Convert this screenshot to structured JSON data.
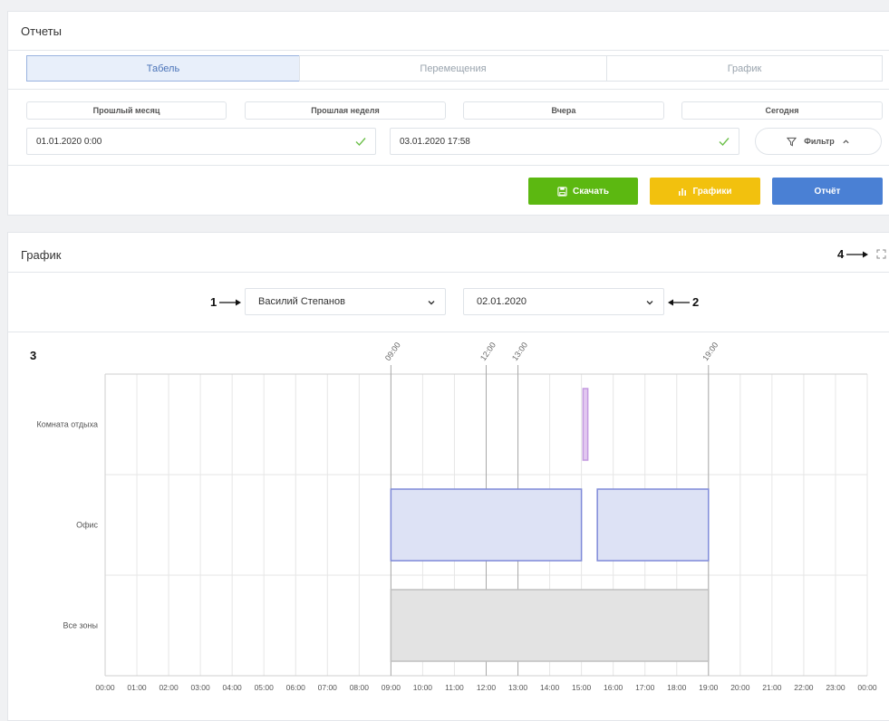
{
  "reports": {
    "title": "Отчеты",
    "tabs": [
      {
        "label": "Табель",
        "active": true
      },
      {
        "label": "Перемещения",
        "active": false
      },
      {
        "label": "График",
        "active": false
      }
    ],
    "presets": [
      "Прошлый месяц",
      "Прошлая неделя",
      "Вчера",
      "Сегодня"
    ],
    "date_from": "01.01.2020 0:00",
    "date_to": "03.01.2020 17:58",
    "filter_label": "Фильтр",
    "buttons": {
      "download": "Скачать",
      "graphs": "Графики",
      "report": "Отчёт"
    },
    "colors": {
      "download": "#5cb811",
      "graphs": "#f2c10e",
      "report": "#4a80d4",
      "accent": "#4a73b8"
    }
  },
  "graph_panel": {
    "title": "График",
    "employee": "Василий Степанов",
    "date": "02.01.2020",
    "annotations": {
      "employee": "1",
      "date": "2",
      "chart": "3",
      "fullscreen": "4"
    }
  },
  "chart_data": {
    "type": "gantt",
    "rows": [
      "Комната отдыха",
      "Офис",
      "Все зоны"
    ],
    "x_ticks": [
      "00:00",
      "01:00",
      "02:00",
      "03:00",
      "04:00",
      "05:00",
      "06:00",
      "07:00",
      "08:00",
      "09:00",
      "10:00",
      "11:00",
      "12:00",
      "13:00",
      "14:00",
      "15:00",
      "16:00",
      "17:00",
      "18:00",
      "19:00",
      "20:00",
      "21:00",
      "22:00",
      "23:00",
      "00:00"
    ],
    "xlim": [
      0,
      24
    ],
    "markers": [
      {
        "label": "09:00",
        "hour": 9
      },
      {
        "label": "12:00",
        "hour": 12
      },
      {
        "label": "13:00",
        "hour": 13
      },
      {
        "label": "19:00",
        "hour": 19
      }
    ],
    "bars": [
      {
        "row": "Комната отдыха",
        "start": 15.05,
        "end": 15.2,
        "color": "#e2c8f0",
        "stroke": "#c39ae0"
      },
      {
        "row": "Офис",
        "start": 9.0,
        "end": 15.0,
        "color": "#dde2f5",
        "stroke": "#7f8ad8"
      },
      {
        "row": "Офис",
        "start": 15.5,
        "end": 19.0,
        "color": "#dde2f5",
        "stroke": "#7f8ad8"
      },
      {
        "row": "Все зоны",
        "start": 9.0,
        "end": 19.0,
        "color": "#e3e3e3",
        "stroke": "#bfbfbf"
      }
    ]
  }
}
